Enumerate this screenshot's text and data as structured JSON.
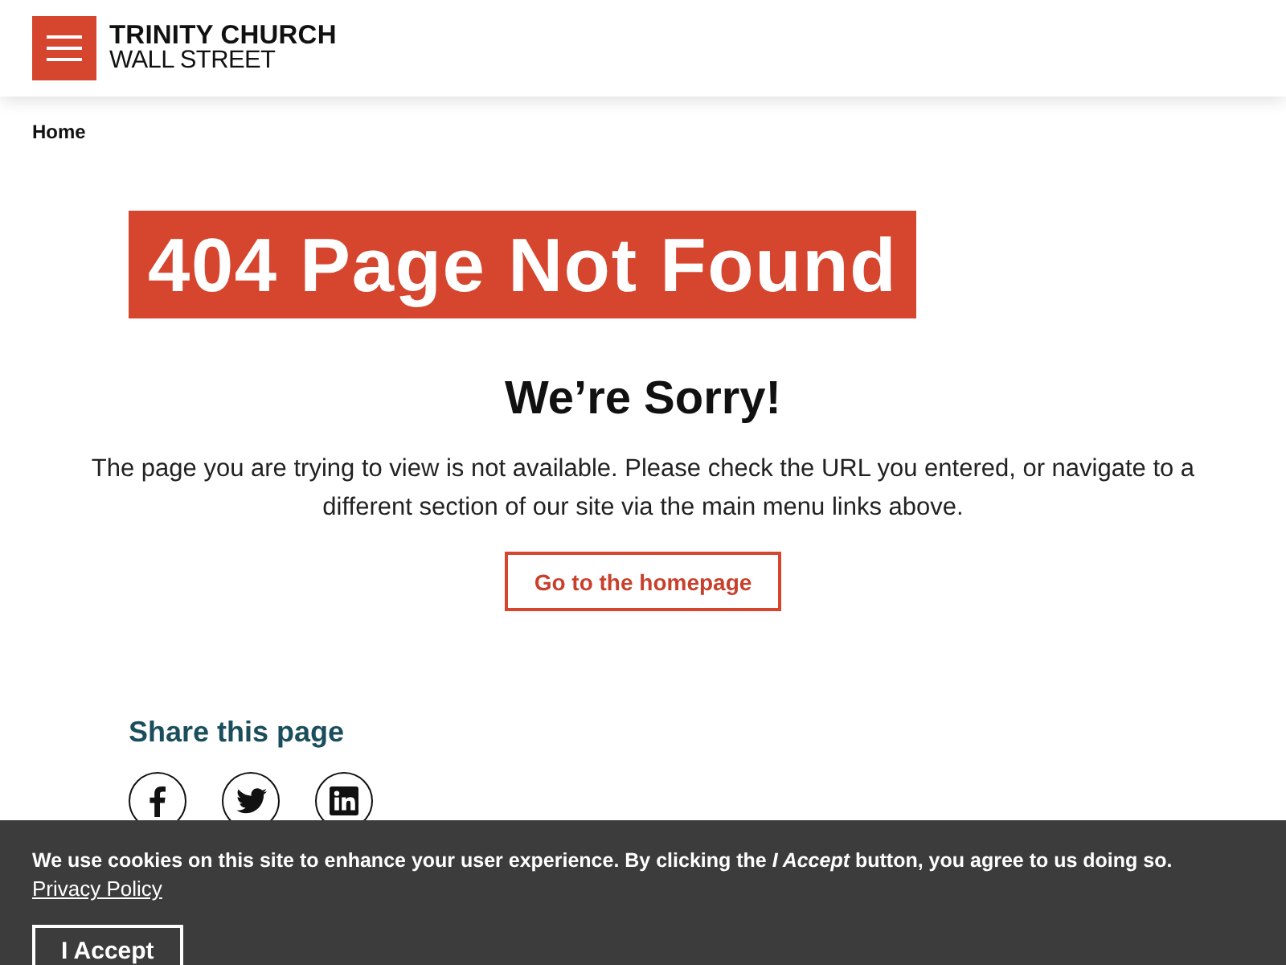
{
  "header": {
    "logo": {
      "line_1": "TRINITY CHURCH",
      "line_2": "WALL STREET"
    }
  },
  "breadcrumb": [
    {
      "label": "Home"
    }
  ],
  "error_banner": "404 Page Not Found",
  "heading": "We’re Sorry!",
  "message": "The page you are trying to view is not available. Please check the URL you entered, or navigate to a different section of our site via the main menu links above.",
  "home_button": "Go to the homepage",
  "share": {
    "title": "Share this page",
    "links": [
      {
        "kind": "facebook"
      },
      {
        "kind": "twitter"
      },
      {
        "kind": "linkedin"
      }
    ]
  },
  "cookie_banner": {
    "text": "We use cookies on this site to enhance your user experience. By clicking the *I Accept* button, you agree to us doing so.",
    "privacy_link": "Privacy Policy",
    "accept_button": "I Accept"
  }
}
